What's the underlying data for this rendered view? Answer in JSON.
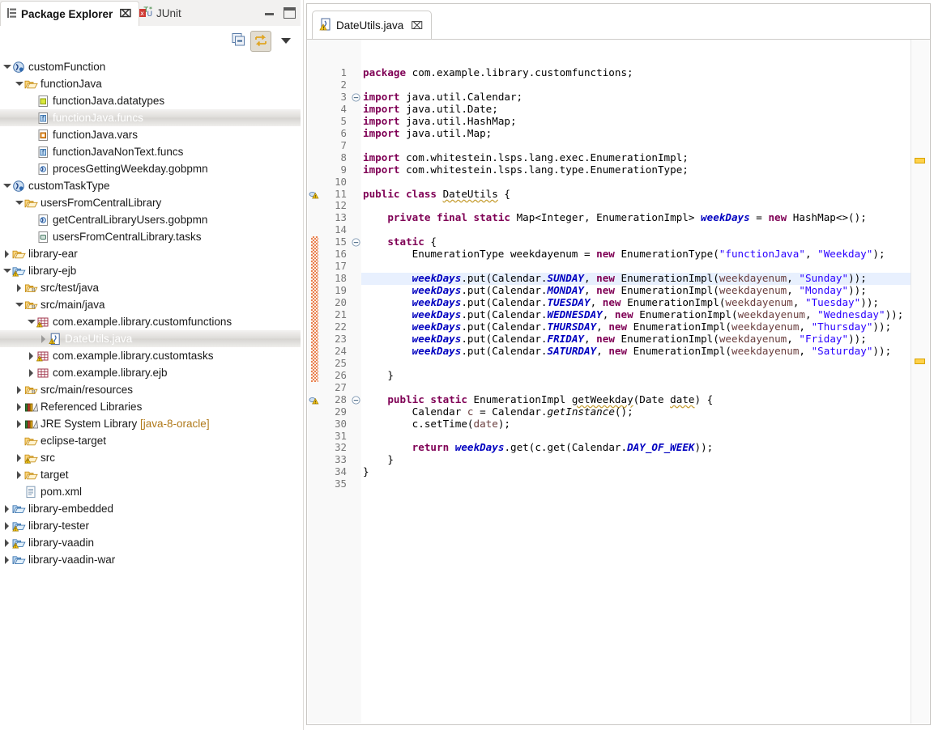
{
  "window": {
    "minimize_label": "Minimize",
    "maximize_label": "Maximize"
  },
  "view_tabs": [
    {
      "label": "Package Explorer",
      "icon": "package-explorer-icon",
      "active": true,
      "close": "⌧"
    },
    {
      "label": "JUnit",
      "icon": "junit-icon",
      "active": false
    }
  ],
  "view_toolbar": [
    {
      "name": "collapse-all-button",
      "icon": "collapse-all-icon",
      "pressed": false
    },
    {
      "name": "link-with-editor-button",
      "icon": "link-with-editor-icon",
      "pressed": true
    },
    {
      "name": "view-menu-button",
      "icon": "chevron-down-icon",
      "pressed": false
    }
  ],
  "tree": {
    "items": [
      {
        "label": "customFunction",
        "indent": 0,
        "twisty": "down",
        "icon": "module-icon",
        "selected": false
      },
      {
        "label": "functionJava",
        "indent": 1,
        "twisty": "down",
        "icon": "folder-open-icon",
        "selected": false
      },
      {
        "label": "functionJava.datatypes",
        "indent": 2,
        "twisty": "none",
        "icon": "datatypes-file-icon",
        "selected": false
      },
      {
        "label": "functionJava.funcs",
        "indent": 2,
        "twisty": "none",
        "icon": "funcs-file-icon",
        "selected": true
      },
      {
        "label": "functionJava.vars",
        "indent": 2,
        "twisty": "none",
        "icon": "vars-file-icon",
        "selected": false
      },
      {
        "label": "functionJavaNonText.funcs",
        "indent": 2,
        "twisty": "none",
        "icon": "funcs-file-icon",
        "selected": false
      },
      {
        "label": "procesGettingWeekday.gobpmn",
        "indent": 2,
        "twisty": "none",
        "icon": "gobpmn-file-icon",
        "selected": false
      },
      {
        "label": "customTaskType",
        "indent": 0,
        "twisty": "down",
        "icon": "module-icon",
        "selected": false
      },
      {
        "label": "usersFromCentralLibrary",
        "indent": 1,
        "twisty": "down",
        "icon": "folder-open-icon",
        "selected": false
      },
      {
        "label": "getCentralLibraryUsers.gobpmn",
        "indent": 2,
        "twisty": "none",
        "icon": "gobpmn-file-icon",
        "selected": false
      },
      {
        "label": "usersFromCentralLibrary.tasks",
        "indent": 2,
        "twisty": "none",
        "icon": "tasks-file-icon",
        "selected": false
      },
      {
        "label": "library-ear",
        "indent": 0,
        "twisty": "right",
        "icon": "folder-open-icon",
        "selected": false
      },
      {
        "label": "library-ejb",
        "indent": 0,
        "twisty": "down",
        "icon": "java-project-warning-icon",
        "selected": false
      },
      {
        "label": "src/test/java",
        "indent": 1,
        "twisty": "right",
        "icon": "source-folder-icon",
        "selected": false
      },
      {
        "label": "src/main/java",
        "indent": 1,
        "twisty": "down",
        "icon": "source-folder-icon",
        "selected": false
      },
      {
        "label": "com.example.library.customfunctions",
        "indent": 2,
        "twisty": "down",
        "icon": "package-warning-icon",
        "selected": false
      },
      {
        "label": "DateUtils.java",
        "indent": 3,
        "twisty": "right",
        "icon": "java-file-warning-icon",
        "selected": true
      },
      {
        "label": "com.example.library.customtasks",
        "indent": 2,
        "twisty": "right",
        "icon": "package-warning-icon",
        "selected": false
      },
      {
        "label": "com.example.library.ejb",
        "indent": 2,
        "twisty": "right",
        "icon": "package-icon",
        "selected": false
      },
      {
        "label": "src/main/resources",
        "indent": 1,
        "twisty": "right",
        "icon": "source-folder-icon",
        "selected": false
      },
      {
        "label": "Referenced Libraries",
        "indent": 1,
        "twisty": "right",
        "icon": "libraries-icon",
        "selected": false
      },
      {
        "label": "JRE System Library ",
        "suffix": "[java-8-oracle]",
        "indent": 1,
        "twisty": "right",
        "icon": "libraries-icon",
        "selected": false
      },
      {
        "label": "eclipse-target",
        "indent": 1,
        "twisty": "none",
        "icon": "folder-open-icon",
        "selected": false
      },
      {
        "label": "src",
        "indent": 1,
        "twisty": "right",
        "icon": "folder-warning-icon",
        "selected": false
      },
      {
        "label": "target",
        "indent": 1,
        "twisty": "right",
        "icon": "folder-open-icon",
        "selected": false
      },
      {
        "label": "pom.xml",
        "indent": 1,
        "twisty": "none",
        "icon": "xml-file-icon",
        "selected": false
      },
      {
        "label": "library-embedded",
        "indent": 0,
        "twisty": "right",
        "icon": "java-project-icon",
        "selected": false
      },
      {
        "label": "library-tester",
        "indent": 0,
        "twisty": "right",
        "icon": "java-project-warning-icon",
        "selected": false
      },
      {
        "label": "library-vaadin",
        "indent": 0,
        "twisty": "right",
        "icon": "java-project-warning-icon",
        "selected": false
      },
      {
        "label": "library-vaadin-war",
        "indent": 0,
        "twisty": "right",
        "icon": "java-project-icon",
        "selected": false
      }
    ]
  },
  "editor": {
    "tab": {
      "label": "DateUtils.java",
      "icon": "java-file-warning-icon",
      "close": "⌧"
    },
    "first_line": 1,
    "last_line": 35,
    "highlighted_line": 18,
    "warning_lines": [
      11,
      28
    ],
    "fold_lines": [
      3,
      15,
      28
    ],
    "change_bar_lines": [
      15,
      26
    ],
    "overview_markers": [
      11,
      28
    ],
    "code": [
      {
        "n": 1,
        "tokens": [
          [
            "k",
            "package"
          ],
          [
            "t",
            " com.example.library.customfunctions;"
          ]
        ]
      },
      {
        "n": 2,
        "tokens": []
      },
      {
        "n": 3,
        "tokens": [
          [
            "k",
            "import"
          ],
          [
            "t",
            " java.util.Calendar;"
          ]
        ]
      },
      {
        "n": 4,
        "tokens": [
          [
            "k",
            "import"
          ],
          [
            "t",
            " java.util.Date;"
          ]
        ]
      },
      {
        "n": 5,
        "tokens": [
          [
            "k",
            "import"
          ],
          [
            "t",
            " java.util.HashMap;"
          ]
        ]
      },
      {
        "n": 6,
        "tokens": [
          [
            "k",
            "import"
          ],
          [
            "t",
            " java.util.Map;"
          ]
        ]
      },
      {
        "n": 7,
        "tokens": []
      },
      {
        "n": 8,
        "tokens": [
          [
            "k",
            "import"
          ],
          [
            "t",
            " com.whitestein.lsps.lang.exec.EnumerationImpl;"
          ]
        ]
      },
      {
        "n": 9,
        "tokens": [
          [
            "k",
            "import"
          ],
          [
            "t",
            " com.whitestein.lsps.lang.type.EnumerationType;"
          ]
        ]
      },
      {
        "n": 10,
        "tokens": []
      },
      {
        "n": 11,
        "tokens": [
          [
            "k",
            "public class "
          ],
          [
            "decl",
            "DateUtils"
          ],
          [
            "t",
            " {"
          ]
        ]
      },
      {
        "n": 12,
        "tokens": []
      },
      {
        "n": 13,
        "tokens": [
          [
            "t",
            "    "
          ],
          [
            "k",
            "private final static"
          ],
          [
            "t",
            " Map<Integer, EnumerationImpl> "
          ],
          [
            "f",
            "weekDays"
          ],
          [
            "t",
            " = "
          ],
          [
            "k",
            "new"
          ],
          [
            "t",
            " HashMap<>();"
          ]
        ]
      },
      {
        "n": 14,
        "tokens": []
      },
      {
        "n": 15,
        "tokens": [
          [
            "t",
            "    "
          ],
          [
            "k",
            "static"
          ],
          [
            "t",
            " {"
          ]
        ]
      },
      {
        "n": 16,
        "tokens": [
          [
            "t",
            "        EnumerationType weekdayenum = "
          ],
          [
            "k",
            "new"
          ],
          [
            "t",
            " EnumerationType("
          ],
          [
            "s",
            "\"functionJava\""
          ],
          [
            "t",
            ", "
          ],
          [
            "s",
            "\"Weekday\""
          ],
          [
            "t",
            ");"
          ]
        ]
      },
      {
        "n": 17,
        "tokens": []
      },
      {
        "n": 18,
        "tokens": [
          [
            "t",
            "        "
          ],
          [
            "f",
            "weekDays"
          ],
          [
            "t",
            ".put(Calendar."
          ],
          [
            "sf",
            "SUNDAY"
          ],
          [
            "t",
            ", "
          ],
          [
            "k",
            "new"
          ],
          [
            "t",
            " EnumerationImpl("
          ],
          [
            "p",
            "weekdayenum"
          ],
          [
            "t",
            ", "
          ],
          [
            "s",
            "\"Sunday\""
          ],
          [
            "t",
            "));"
          ]
        ]
      },
      {
        "n": 19,
        "tokens": [
          [
            "t",
            "        "
          ],
          [
            "f",
            "weekDays"
          ],
          [
            "t",
            ".put(Calendar."
          ],
          [
            "sf",
            "MONDAY"
          ],
          [
            "t",
            ", "
          ],
          [
            "k",
            "new"
          ],
          [
            "t",
            " EnumerationImpl("
          ],
          [
            "p",
            "weekdayenum"
          ],
          [
            "t",
            ", "
          ],
          [
            "s",
            "\"Monday\""
          ],
          [
            "t",
            "));"
          ]
        ]
      },
      {
        "n": 20,
        "tokens": [
          [
            "t",
            "        "
          ],
          [
            "f",
            "weekDays"
          ],
          [
            "t",
            ".put(Calendar."
          ],
          [
            "sf",
            "TUESDAY"
          ],
          [
            "t",
            ", "
          ],
          [
            "k",
            "new"
          ],
          [
            "t",
            " EnumerationImpl("
          ],
          [
            "p",
            "weekdayenum"
          ],
          [
            "t",
            ", "
          ],
          [
            "s",
            "\"Tuesday\""
          ],
          [
            "t",
            "));"
          ]
        ]
      },
      {
        "n": 21,
        "tokens": [
          [
            "t",
            "        "
          ],
          [
            "f",
            "weekDays"
          ],
          [
            "t",
            ".put(Calendar."
          ],
          [
            "sf",
            "WEDNESDAY"
          ],
          [
            "t",
            ", "
          ],
          [
            "k",
            "new"
          ],
          [
            "t",
            " EnumerationImpl("
          ],
          [
            "p",
            "weekdayenum"
          ],
          [
            "t",
            ", "
          ],
          [
            "s",
            "\"Wednesday\""
          ],
          [
            "t",
            "));"
          ]
        ]
      },
      {
        "n": 22,
        "tokens": [
          [
            "t",
            "        "
          ],
          [
            "f",
            "weekDays"
          ],
          [
            "t",
            ".put(Calendar."
          ],
          [
            "sf",
            "THURSDAY"
          ],
          [
            "t",
            ", "
          ],
          [
            "k",
            "new"
          ],
          [
            "t",
            " EnumerationImpl("
          ],
          [
            "p",
            "weekdayenum"
          ],
          [
            "t",
            ", "
          ],
          [
            "s",
            "\"Thursday\""
          ],
          [
            "t",
            "));"
          ]
        ]
      },
      {
        "n": 23,
        "tokens": [
          [
            "t",
            "        "
          ],
          [
            "f",
            "weekDays"
          ],
          [
            "t",
            ".put(Calendar."
          ],
          [
            "sf",
            "FRIDAY"
          ],
          [
            "t",
            ", "
          ],
          [
            "k",
            "new"
          ],
          [
            "t",
            " EnumerationImpl("
          ],
          [
            "p",
            "weekdayenum"
          ],
          [
            "t",
            ", "
          ],
          [
            "s",
            "\"Friday\""
          ],
          [
            "t",
            "));"
          ]
        ]
      },
      {
        "n": 24,
        "tokens": [
          [
            "t",
            "        "
          ],
          [
            "f",
            "weekDays"
          ],
          [
            "t",
            ".put(Calendar."
          ],
          [
            "sf",
            "SATURDAY"
          ],
          [
            "t",
            ", "
          ],
          [
            "k",
            "new"
          ],
          [
            "t",
            " EnumerationImpl("
          ],
          [
            "p",
            "weekdayenum"
          ],
          [
            "t",
            ", "
          ],
          [
            "s",
            "\"Saturday\""
          ],
          [
            "t",
            "));"
          ]
        ]
      },
      {
        "n": 25,
        "tokens": []
      },
      {
        "n": 26,
        "tokens": [
          [
            "t",
            "    }"
          ]
        ]
      },
      {
        "n": 27,
        "tokens": []
      },
      {
        "n": 28,
        "tokens": [
          [
            "t",
            "    "
          ],
          [
            "k",
            "public static"
          ],
          [
            "t",
            " EnumerationImpl "
          ],
          [
            "decl",
            "getWeekday"
          ],
          [
            "t",
            "(Date "
          ],
          [
            "decl",
            "date"
          ],
          [
            "t",
            ") {"
          ]
        ]
      },
      {
        "n": 29,
        "tokens": [
          [
            "t",
            "        Calendar "
          ],
          [
            "p",
            "c"
          ],
          [
            "t",
            " = Calendar."
          ],
          [
            "st",
            "getInstance"
          ],
          [
            "t",
            "();"
          ]
        ]
      },
      {
        "n": 30,
        "tokens": [
          [
            "t",
            "        c.setTime("
          ],
          [
            "p",
            "date"
          ],
          [
            "t",
            ");"
          ]
        ]
      },
      {
        "n": 31,
        "tokens": []
      },
      {
        "n": 32,
        "tokens": [
          [
            "t",
            "        "
          ],
          [
            "k",
            "return"
          ],
          [
            "t",
            " "
          ],
          [
            "f",
            "weekDays"
          ],
          [
            "t",
            ".get(c.get(Calendar."
          ],
          [
            "sf",
            "DAY_OF_WEEK"
          ],
          [
            "t",
            "));"
          ]
        ]
      },
      {
        "n": 33,
        "tokens": [
          [
            "t",
            "    }"
          ]
        ]
      },
      {
        "n": 34,
        "tokens": [
          [
            "t",
            "}"
          ]
        ]
      },
      {
        "n": 35,
        "tokens": []
      }
    ]
  },
  "colors": {
    "keyword": "#7f0055",
    "string": "#2a00ff",
    "field": "#0000c0",
    "parameter": "#6a3e3e",
    "plain": "#000000",
    "selection_bg": "#e8f0fe",
    "change_bar": "#e8804f",
    "warning_marker": "#ffd24d",
    "tree_selection": "#dedcd9"
  }
}
